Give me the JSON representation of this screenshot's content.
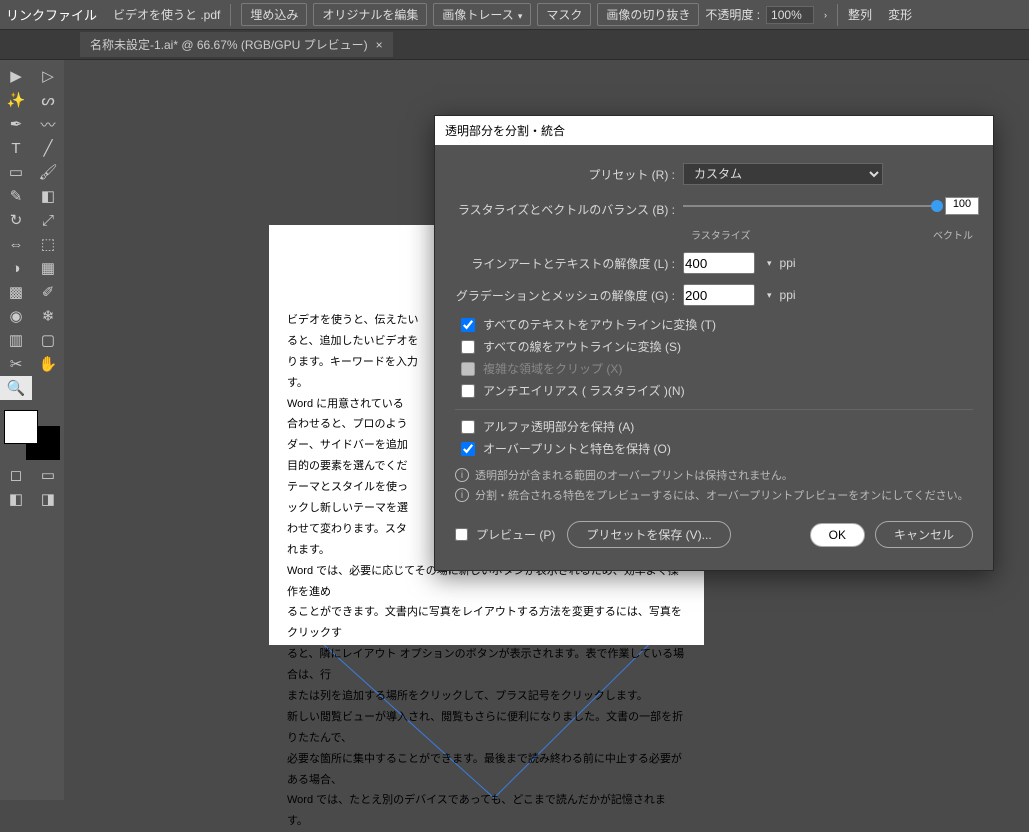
{
  "topbar": {
    "linkfile": "リンクファイル",
    "filename": "ビデオを使うと .pdf",
    "embed": "埋め込み",
    "edit_original": "オリジナルを編集",
    "image_trace": "画像トレース",
    "mask": "マスク",
    "crop_image": "画像の切り抜き",
    "opacity_label": "不透明度 :",
    "opacity_value": "100%",
    "arrange": "整列",
    "transform": "変形"
  },
  "doctab": {
    "title": "名称未設定-1.ai* @ 66.67% (RGB/GPU プレビュー)",
    "close": "×"
  },
  "page_text": [
    "ビデオを使うと、伝えたい",
    "ると、追加したいビデオを",
    "ります。キーワードを入力",
    "す。",
    "Word に用意されている",
    "合わせると、プロのよう",
    "ダー、サイドバーを追加",
    "目的の要素を選んでくだ",
    "テーマとスタイルを使っ",
    "ックし新しいテーマを選",
    "わせて変わります。スタ",
    "れます。",
    "Word では、必要に応じてその場に新しいボタンが表示されるため、効率よく操作を進め",
    "ることができます。文書内に写真をレイアウトする方法を変更するには、写真をクリックす",
    "ると、隣にレイアウト オプションのボタンが表示されます。表で作業している場合は、行",
    "または列を追加する場所をクリックして、プラス記号をクリックします。",
    "新しい閲覧ビューが導入され、閲覧もさらに便利になりました。文書の一部を折りたたんで、",
    "必要な箇所に集中することができます。最後まで読み終わる前に中止する必要がある場合、",
    "Word では、たとえ別のデバイスであっても、どこまで読んだかが記憶されます。"
  ],
  "dialog": {
    "title": "透明部分を分割・統合",
    "preset_label": "プリセット (R) :",
    "preset_value": "カスタム",
    "balance_label": "ラスタライズとベクトルのバランス (B) :",
    "balance_value": "100",
    "balance_left": "ラスタライズ",
    "balance_right": "ベクトル",
    "lineart_label": "ラインアートとテキストの解像度 (L) :",
    "lineart_value": "400",
    "gradient_label": "グラデーションとメッシュの解像度 (G) :",
    "gradient_value": "200",
    "ppi": "ppi",
    "check_text_outline": "すべてのテキストをアウトラインに変換 (T)",
    "check_stroke_outline": "すべての線をアウトラインに変換 (S)",
    "check_clip": "複雑な領域をクリップ (X)",
    "check_antialias": "アンチエイリアス ( ラスタライズ )(N)",
    "check_alpha": "アルファ透明部分を保持 (A)",
    "check_overprint": "オーバープリントと特色を保持 (O)",
    "info1": "透明部分が含まれる範囲のオーバープリントは保持されません。",
    "info2": "分割・統合される特色をプレビューするには、オーバープリントプレビューをオンにしてください。",
    "preview": "プレビュー (P)",
    "save_preset": "プリセットを保存 (V)...",
    "ok": "OK",
    "cancel": "キャンセル"
  }
}
